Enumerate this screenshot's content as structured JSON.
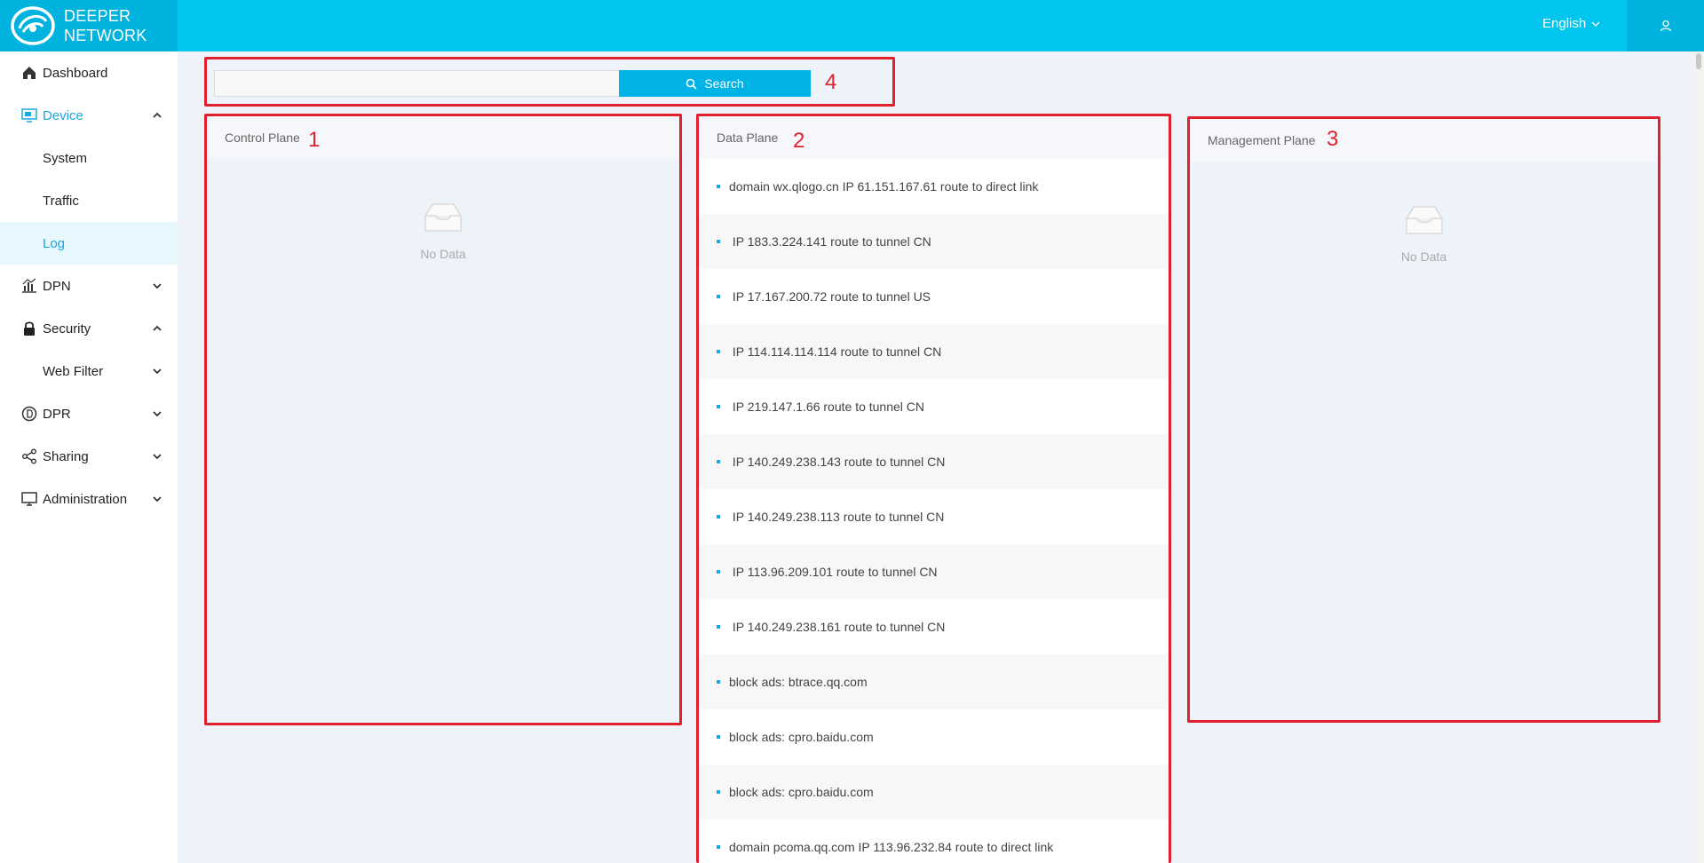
{
  "header": {
    "brand_line1": "DEEPER",
    "brand_line2": "NETWORK",
    "language": "English"
  },
  "sidebar": {
    "items": [
      {
        "label": "Dashboard"
      },
      {
        "label": "Device"
      },
      {
        "label": "System"
      },
      {
        "label": "Traffic"
      },
      {
        "label": "Log"
      },
      {
        "label": "DPN"
      },
      {
        "label": "Security"
      },
      {
        "label": "Web Filter"
      },
      {
        "label": "DPR"
      },
      {
        "label": "Sharing"
      },
      {
        "label": "Administration"
      }
    ]
  },
  "search": {
    "value": "",
    "placeholder": "",
    "button_label": "Search",
    "annotation": "4"
  },
  "panels": {
    "control": {
      "title": "Control Plane",
      "annotation": "1",
      "empty_label": "No Data"
    },
    "data": {
      "title": "Data Plane",
      "annotation": "2"
    },
    "management": {
      "title": "Management Plane",
      "annotation": "3",
      "empty_label": "No Data"
    }
  },
  "data_plane_logs": [
    "domain wx.qlogo.cn IP 61.151.167.61 route to direct link",
    " IP 183.3.224.141 route to tunnel CN",
    " IP 17.167.200.72 route to tunnel US",
    " IP 114.114.114.114 route to tunnel CN",
    " IP 219.147.1.66 route to tunnel CN",
    " IP 140.249.238.143 route to tunnel CN",
    " IP 140.249.238.113 route to tunnel CN",
    " IP 113.96.209.101 route to tunnel CN",
    " IP 140.249.238.161 route to tunnel CN",
    "block ads: btrace.qq.com",
    "block ads: cpro.baidu.com",
    "block ads: cpro.baidu.com",
    "domain pcoma.qq.com IP 113.96.232.84 route to direct link"
  ],
  "colors": {
    "header": "#00c5ee",
    "accent": "#1aa8de",
    "annotation_red": "#e0202c"
  }
}
